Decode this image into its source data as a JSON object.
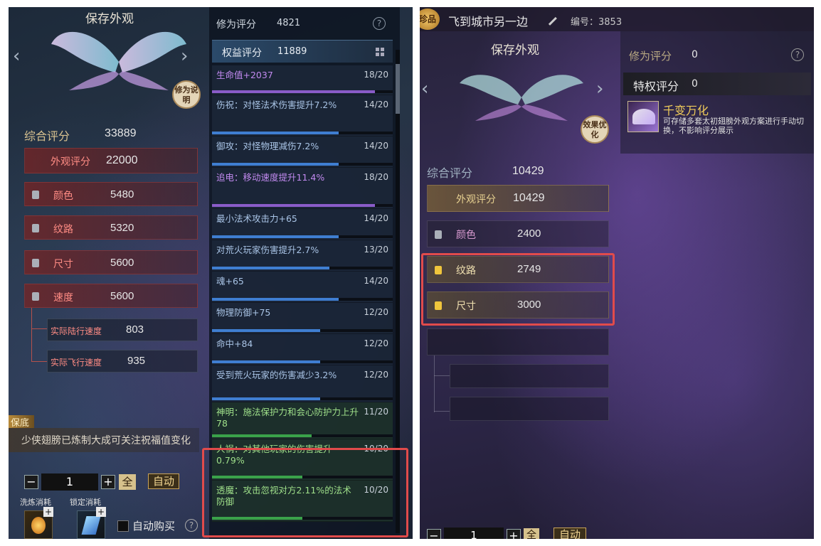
{
  "left": {
    "title": "保存外观",
    "explain_btn": "修为说明",
    "cultivation": {
      "label": "修为评分",
      "value": "4821"
    },
    "rights": {
      "label": "权益评分",
      "value": "11889"
    },
    "overall": {
      "label": "综合评分",
      "value": "33889"
    },
    "appearance": {
      "label": "外观评分",
      "value": "22000"
    },
    "attrs": [
      {
        "label": "颜色",
        "value": "5480"
      },
      {
        "label": "纹路",
        "value": "5320"
      },
      {
        "label": "尺寸",
        "value": "5600"
      },
      {
        "label": "速度",
        "value": "5600"
      }
    ],
    "sub": [
      {
        "label": "实际陆行速度",
        "value": "803"
      },
      {
        "label": "实际飞行速度",
        "value": "935"
      }
    ],
    "stats": [
      {
        "text": "生命值+2037",
        "score": "18/20",
        "fill": 0.9,
        "color": "purple"
      },
      {
        "text": "伤祝：对怪法术伤害提升7.2%",
        "score": "14/20",
        "fill": 0.7,
        "color": "blue"
      },
      {
        "text": "御攻：对怪物理减伤7.2%",
        "score": "14/20",
        "fill": 0.7,
        "color": "blue"
      },
      {
        "text": "追电：移动速度提升11.4%",
        "score": "18/20",
        "fill": 0.9,
        "color": "purple"
      },
      {
        "text": "最小法术攻击力+65",
        "score": "14/20",
        "fill": 0.7,
        "color": "blue"
      },
      {
        "text": "对荒火玩家伤害提升2.7%",
        "score": "13/20",
        "fill": 0.65,
        "color": "blue"
      },
      {
        "text": "魂+65",
        "score": "14/20",
        "fill": 0.7,
        "color": "blue"
      },
      {
        "text": "物理防御+75",
        "score": "12/20",
        "fill": 0.6,
        "color": "blue"
      },
      {
        "text": "命中+84",
        "score": "12/20",
        "fill": 0.6,
        "color": "blue"
      },
      {
        "text": "受到荒火玩家的伤害减少3.2%",
        "score": "12/20",
        "fill": 0.6,
        "color": "blue"
      },
      {
        "text": "神明：施法保护力和会心防护力上升78",
        "score": "11/20",
        "fill": 0.55,
        "color": "green"
      },
      {
        "text": "人祸：对其他玩家的伤害提升0.79%",
        "score": "10/20",
        "fill": 0.5,
        "color": "green"
      },
      {
        "text": "透魔：攻击忽视对方2.11%的法术防御",
        "score": "10/20",
        "fill": 0.5,
        "color": "green"
      }
    ],
    "guarantee_tag": "保底",
    "notice": "少侠翅膀已炼制大成可关注祝福值变化",
    "qty": "1",
    "qty_minus": "−",
    "qty_plus": "+",
    "all_btn": "全",
    "auto_btn": "自动",
    "wash_cost": "洗炼消耗",
    "lock_cost": "锁定消耗",
    "auto_buy": "自动购买",
    "help": "?"
  },
  "right": {
    "rank_badge": "珍品",
    "location": "飞到城市另一边",
    "id_label": "编号：3853",
    "title": "保存外观",
    "effect_btn": "效果优化",
    "cultivation": {
      "label": "修为评分",
      "value": "0"
    },
    "privilege": {
      "label": "特权评分",
      "value": "0"
    },
    "feature": {
      "name": "千变万化",
      "desc": "可存储多套太初翅膀外观方案进行手动切换，不影响评分展示"
    },
    "overall": {
      "label": "综合评分",
      "value": "10429"
    },
    "appearance": {
      "label": "外观评分",
      "value": "10429"
    },
    "attrs": [
      {
        "label": "颜色",
        "value": "2400"
      },
      {
        "label": "纹路",
        "value": "2749"
      },
      {
        "label": "尺寸",
        "value": "3000"
      }
    ],
    "qty": "1",
    "qty_minus": "−",
    "qty_plus": "+",
    "all_btn": "全",
    "auto_btn": "自动",
    "help": "?"
  },
  "colors": {
    "highlight": "#e14b4b",
    "purple": "#8a5cc8",
    "blue": "#3f7ed1",
    "green": "#3aa24a"
  }
}
